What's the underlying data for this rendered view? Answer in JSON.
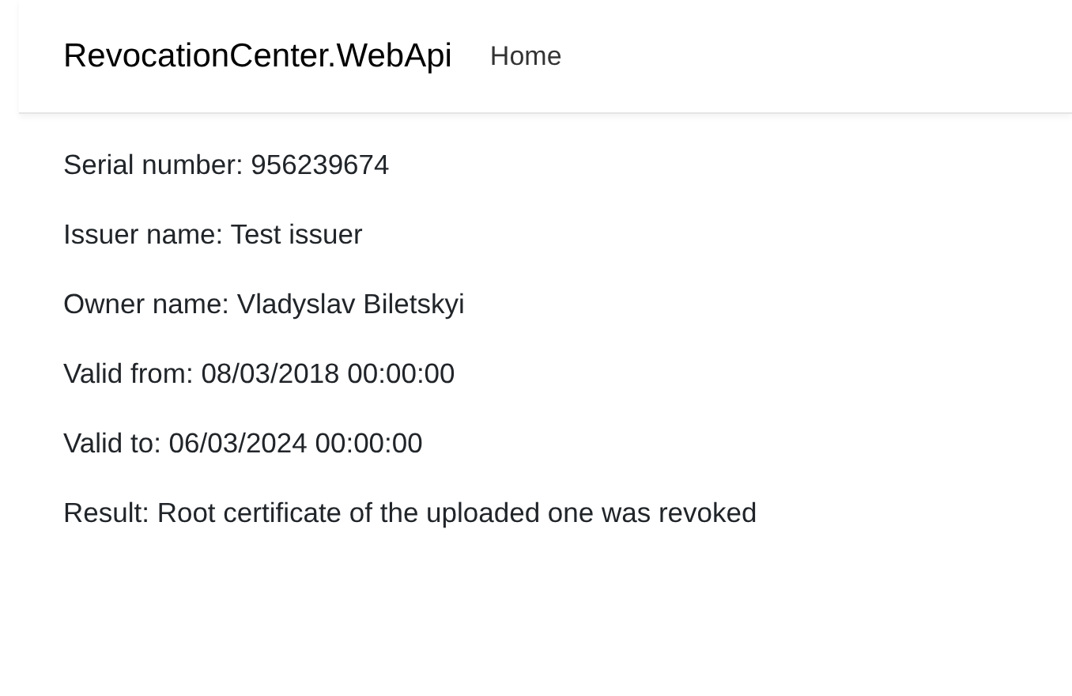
{
  "navbar": {
    "brand": "RevocationCenter.WebApi",
    "links": [
      {
        "label": "Home"
      }
    ]
  },
  "fields": [
    {
      "text": "Serial number: 956239674"
    },
    {
      "text": "Issuer name: Test issuer"
    },
    {
      "text": "Owner name: Vladyslav Biletskyi"
    },
    {
      "text": "Valid from: 08/03/2018 00:00:00"
    },
    {
      "text": "Valid to: 06/03/2024 00:00:00"
    },
    {
      "text": "Result: Root certificate of the uploaded one was revoked"
    }
  ]
}
